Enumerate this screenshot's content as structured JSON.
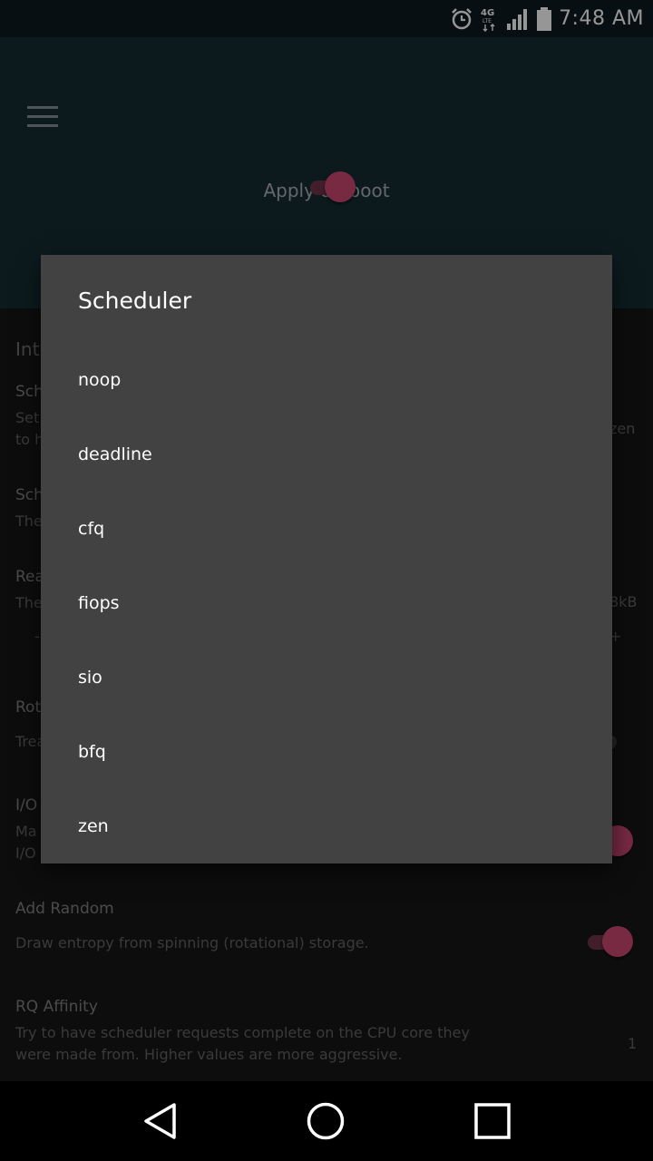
{
  "status_bar": {
    "time": "7:48 AM",
    "network": "4G LTE",
    "icons": [
      "alarm-icon",
      "network-4g-lte-icon",
      "signal-icon",
      "battery-icon"
    ]
  },
  "app_bar": {
    "menu_icon": "hamburger-menu-icon",
    "apply_on_boot_label": "Apply on boot",
    "apply_on_boot_on": true
  },
  "background": {
    "section_header": "Int",
    "items": [
      {
        "title": "Sch",
        "desc_1": "Set",
        "desc_2": "to h",
        "value": "zen"
      },
      {
        "title": "Sch",
        "desc_1": "The"
      },
      {
        "title": "Rea",
        "desc_1": "The",
        "value": "8kB",
        "minus": "-",
        "plus": "+"
      },
      {
        "title": "Rota",
        "desc_1": "Trea"
      },
      {
        "title": "I/O",
        "desc_1": "Ma",
        "desc_2": "I/O"
      },
      {
        "title": "Add Random",
        "desc_1": "Draw entropy from spinning (rotational) storage."
      },
      {
        "title": "RQ Affinity",
        "desc_1": "Try to have scheduler requests complete on the CPU core they",
        "desc_2": "were made from. Higher values are more aggressive.",
        "value": "1"
      }
    ]
  },
  "dialog": {
    "title": "Scheduler",
    "options": [
      "noop",
      "deadline",
      "cfq",
      "fiops",
      "sio",
      "bfq",
      "zen"
    ]
  },
  "nav_bar": {
    "icons": [
      "back-icon",
      "home-icon",
      "recents-icon"
    ]
  },
  "colors": {
    "accent": "#c2446d",
    "app_bar": "#142a31",
    "dialog": "#424242"
  }
}
